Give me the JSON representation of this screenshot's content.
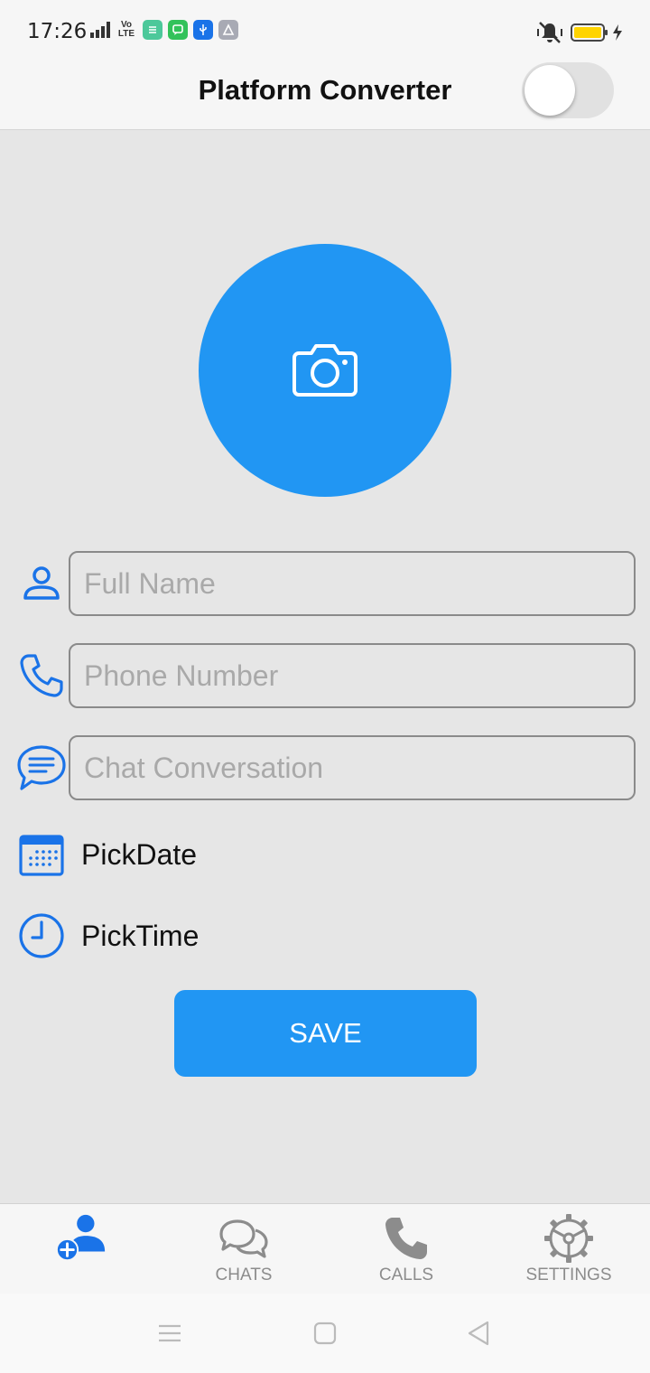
{
  "status_bar": {
    "time": "17:26",
    "network": "Vo LTE"
  },
  "app_bar": {
    "title": "Platform Converter",
    "toggle_on": false
  },
  "form": {
    "full_name": {
      "placeholder": "Full Name",
      "value": ""
    },
    "phone": {
      "placeholder": "Phone Number",
      "value": ""
    },
    "chat": {
      "placeholder": "Chat Conversation",
      "value": ""
    },
    "pick_date_label": "PickDate",
    "pick_time_label": "PickTime",
    "save_label": "SAVE"
  },
  "bottom_nav": {
    "tabs": [
      {
        "label": "",
        "icon": "add-contact-icon",
        "active": true
      },
      {
        "label": "CHATS",
        "icon": "chats-icon",
        "active": false
      },
      {
        "label": "CALLS",
        "icon": "phone-icon",
        "active": false
      },
      {
        "label": "SETTINGS",
        "icon": "settings-gear-icon",
        "active": false
      }
    ]
  },
  "colors": {
    "accent": "#2196f3",
    "background": "#e6e6e6",
    "bar": "#f6f6f6",
    "inactive": "#8c8c8c",
    "battery": "#ffd400"
  }
}
